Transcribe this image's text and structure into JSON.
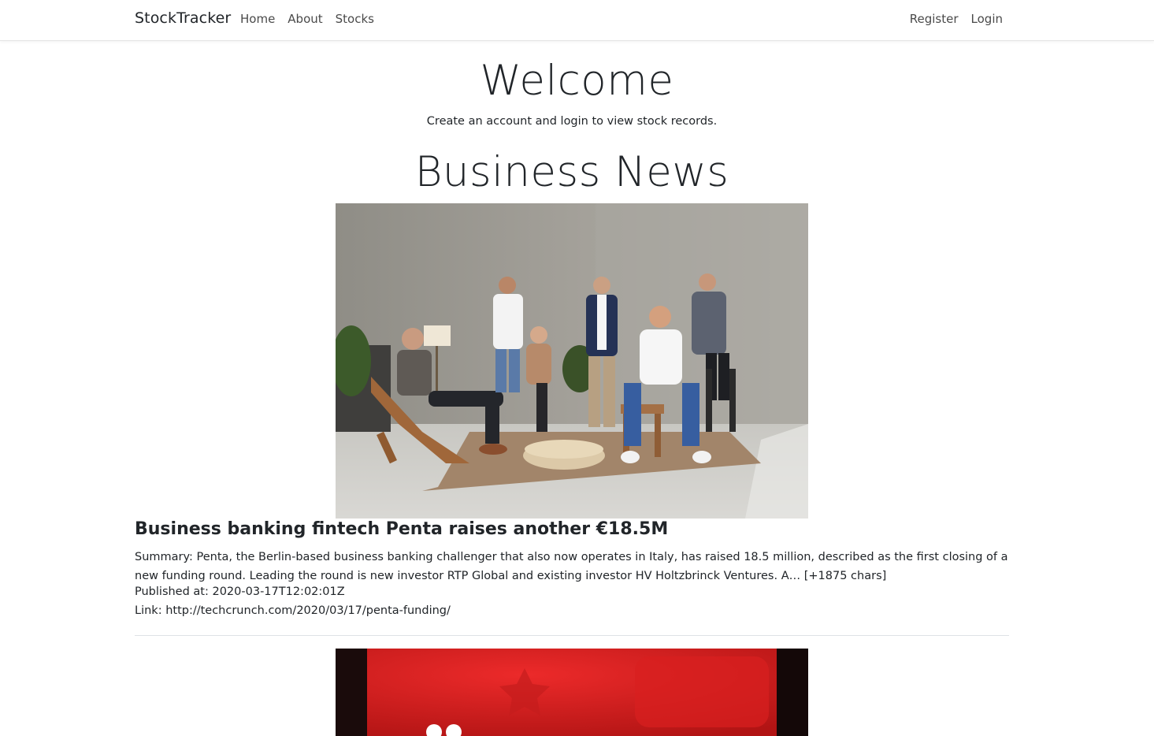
{
  "navbar": {
    "brand": "StockTracker",
    "left_links": [
      "Home",
      "About",
      "Stocks"
    ],
    "right_links": [
      "Register",
      "Login"
    ]
  },
  "hero": {
    "title": "Welcome",
    "subtitle": "Create an account and login to view stock records."
  },
  "news": {
    "heading": "Business News",
    "articles": [
      {
        "title": "Business banking fintech Penta raises another €18.5M",
        "summary": "Summary: Penta, the Berlin-based business banking challenger that also now operates in Italy, has raised 18.5 million, described as the first closing of a new funding round. Leading the round is new investor RTP Global and existing investor HV Holtzbrinck Ventures. A… [+1875 chars]",
        "published": "Published at: 2020-03-17T12:02:01Z",
        "link": "Link: http://techcrunch.com/2020/03/17/penta-funding/"
      }
    ]
  },
  "colors": {
    "text": "#212529",
    "nav_link": "#4a4a4a",
    "divider": "#dee2e6",
    "image2_red": "#d81e1e"
  }
}
